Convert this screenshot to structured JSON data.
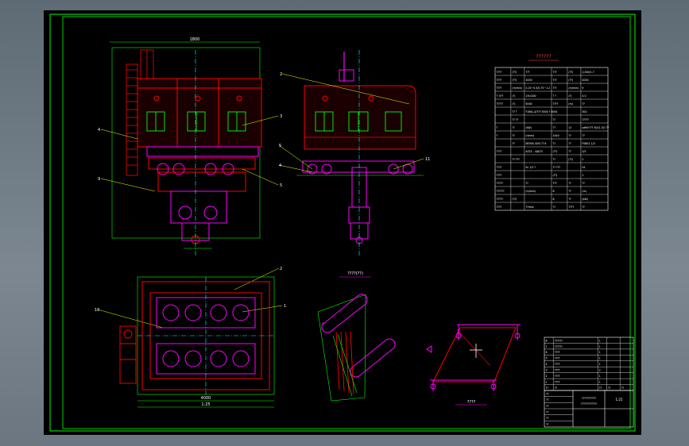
{
  "viewer": {
    "background_colors": [
      "#5e6a74",
      "#7c8791"
    ],
    "sheet_color": "#000000"
  },
  "colors": {
    "frame": "#00ff00",
    "outline": "#ff0000",
    "parts": "#ff00ff",
    "centerline": "#00ffff",
    "cover": "#cc1111",
    "text": "#ffffff",
    "dim": "#00ff00",
    "leader": "#ffff00"
  },
  "drawing": {
    "table_title": "??????",
    "view_label_a": "????(??)",
    "view_label_b": "????",
    "balloons": [
      "1",
      "2",
      "3",
      "4",
      "5",
      "6",
      "7",
      "8",
      "9",
      "10",
      "11"
    ],
    "front_view_width": "1800",
    "plan_view_width": "4000",
    "plan_view_width_2": "1:25"
  },
  "spec_table": {
    "rows": [
      [
        "????",
        "(??)",
        "???",
        "???",
        "(??)",
        "2,000/1.7"
      ],
      [
        "????",
        "(??)",
        "2000",
        "???",
        "(??)",
        "2000"
      ],
      [
        "????",
        "(m/min)",
        "0.25~0.5/0.75~1.2",
        "???",
        "(m/min)",
        "9"
      ],
      [
        "? ?/??",
        "(?)",
        "130,000",
        "? ?",
        "(?)",
        "4.0"
      ],
      [
        "?????",
        "(?)",
        "5000",
        "????",
        "(m)",
        "??"
      ],
      [
        "",
        "?? ?",
        "Y160L-4/??? 5000 ? 5000",
        "",
        "",
        "300"
      ],
      [
        "",
        "?? ??",
        "",
        "??",
        "",
        "?????"
      ],
      [
        "?",
        "??",
        "(kW)",
        "??",
        "11",
        "sdfhh??? 50/(1.5)? ??"
      ],
      [
        "?",
        "??",
        "(r/min)",
        "1440",
        "??",
        "??"
      ],
      [
        "",
        "??",
        "SB300-3/05 ?? 6",
        "??",
        "??",
        "FSB01-1/2"
      ],
      [
        "????",
        "",
        "AZ22 - 4/8/?2",
        "(??)",
        "??",
        "2/2"
      ],
      [
        "",
        "?? ???",
        "",
        "??",
        "(??)",
        "1"
      ],
      [
        "????",
        "",
        "Ss 1/3 ?",
        "?? ???",
        "",
        "54"
      ],
      [
        "????",
        "",
        "",
        "(??)",
        "",
        "1"
      ],
      [
        "?????",
        "",
        "??",
        "???",
        "??",
        "??"
      ],
      [
        "??????",
        "",
        "(m/min)",
        "8",
        "??",
        "(m)"
      ],
      [
        "?????",
        "(??)",
        "",
        "8",
        "??",
        "(kW)"
      ],
      [
        "????",
        "",
        "??/min",
        "??",
        "????",
        "??"
      ]
    ]
  },
  "parts_list": {
    "rows": [
      [
        "8",
        "??????",
        "1",
        "",
        ""
      ],
      [
        "7",
        "??????",
        "1",
        "",
        ""
      ],
      [
        "6",
        "????",
        "1",
        "",
        ""
      ],
      [
        "5",
        "????",
        "1",
        "",
        ""
      ],
      [
        "4",
        "????",
        "1",
        "",
        ""
      ],
      [
        "3",
        "????",
        "2",
        "",
        ""
      ],
      [
        "2",
        "????",
        "1",
        "",
        ""
      ],
      [
        "1",
        "????",
        "1",
        "",
        ""
      ],
      [
        "??",
        "??",
        "??",
        "??",
        "??"
      ]
    ]
  },
  "title_block": {
    "title": "?????????",
    "subtitle": "??????????",
    "scale": "1:25",
    "rows": [
      "??",
      "??",
      "??",
      "??",
      "??",
      "??"
    ]
  }
}
